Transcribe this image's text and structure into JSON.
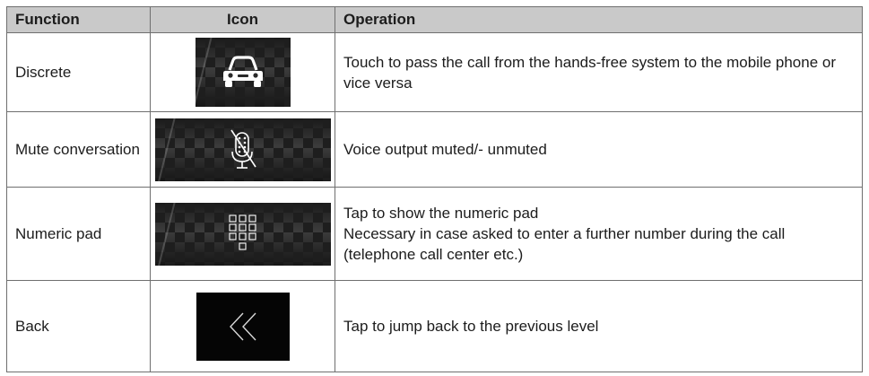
{
  "table": {
    "headers": {
      "function": "Function",
      "icon": "Icon",
      "operation": "Operation"
    },
    "rows": [
      {
        "function": "Discrete",
        "icon": "car-icon",
        "operation": "Touch to pass the call from the hands-free system to the mobile phone or vice versa"
      },
      {
        "function": "Mute conversation",
        "icon": "microphone-muted-icon",
        "operation": "Voice output muted/- unmuted"
      },
      {
        "function": "Numeric pad",
        "icon": "keypad-icon",
        "operation_lines": [
          "Tap to show the numeric pad",
          "Necessary in case asked to enter a further number during the call (telephone call center etc.)"
        ]
      },
      {
        "function": "Back",
        "icon": "double-chevron-left-icon",
        "operation": "Tap to jump back to the previous level"
      }
    ]
  },
  "colors": {
    "header_bg": "#c9c9c9",
    "border": "#6f6f6f",
    "icon_tile": "#303030"
  }
}
